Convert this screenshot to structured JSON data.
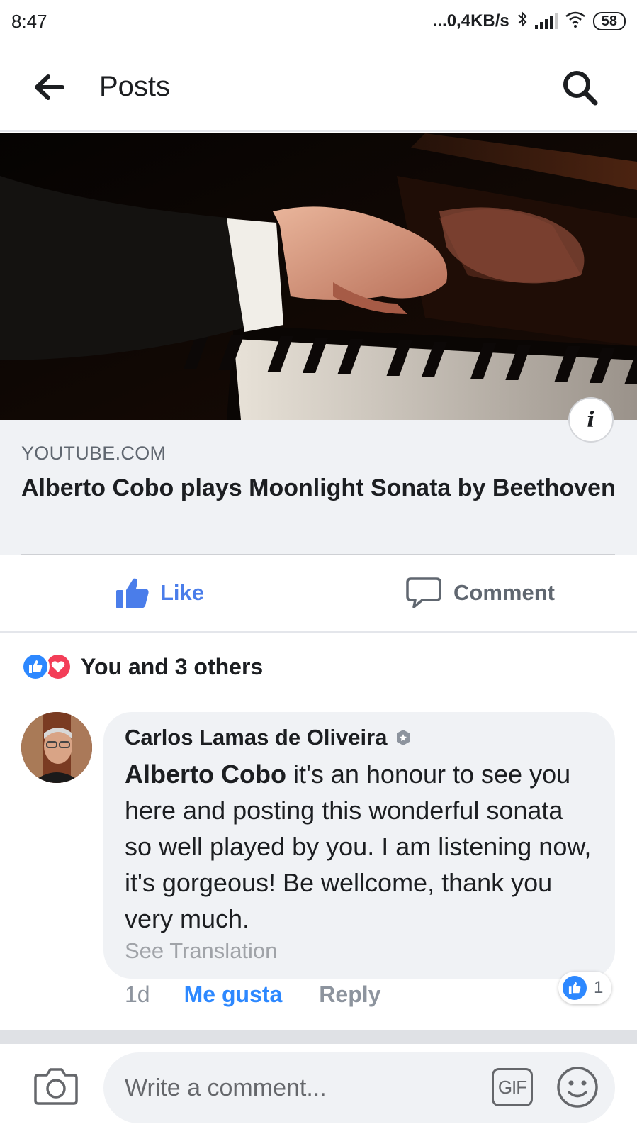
{
  "status_bar": {
    "time": "8:47",
    "network_speed": "...0,4KB/s",
    "battery": "58"
  },
  "header": {
    "title": "Posts",
    "back_icon": "arrow-left-icon",
    "search_icon": "search-icon"
  },
  "link_preview": {
    "domain": "YOUTUBE.COM",
    "title": "Alberto Cobo plays Moonlight Sonata by Beethoven",
    "info_label": "i"
  },
  "actions": {
    "like_label": "Like",
    "comment_label": "Comment"
  },
  "reactions": {
    "summary": "You and 3 others",
    "types": [
      "like",
      "love"
    ]
  },
  "comment": {
    "author": "Carlos Lamas de Oliveira",
    "mention": "Alberto Cobo",
    "text": " it's an honour to see you here and posting this wonderful sonata so well played by you. I am listening now, it's  gorgeous! Be wellcome, thank you very much.",
    "see_translation": "See Translation",
    "time": "1d",
    "like_label": "Me gusta",
    "reply_label": "Reply",
    "reaction_count": "1"
  },
  "composer": {
    "placeholder": "Write a comment...",
    "gif_label": "GIF"
  },
  "colors": {
    "brand_blue": "#2d88ff",
    "like_blue": "#4a7dea",
    "love_red": "#f33e58",
    "bubble_bg": "#f0f2f5"
  }
}
